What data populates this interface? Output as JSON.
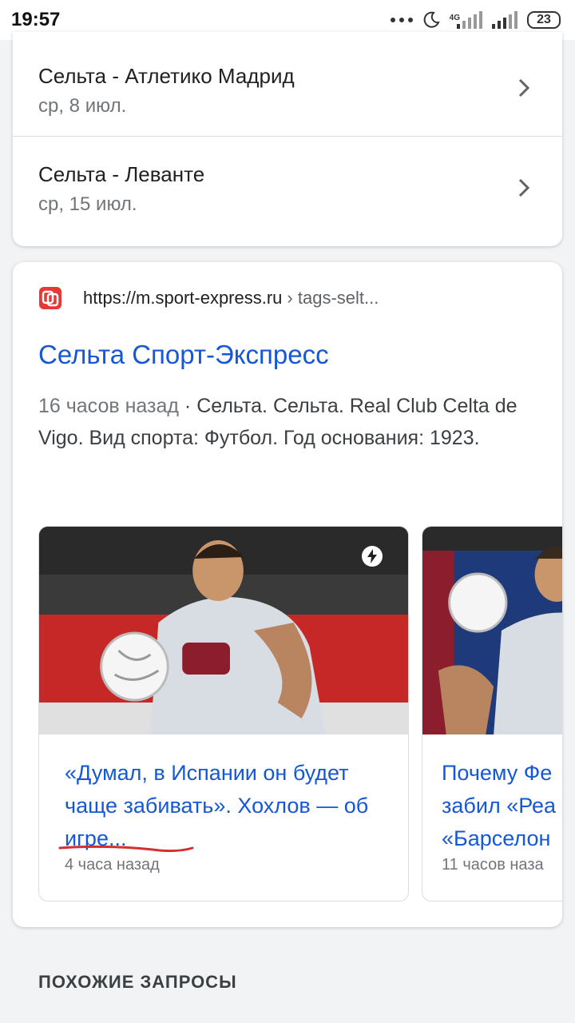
{
  "status_bar": {
    "time": "19:57",
    "network": "4G",
    "battery": "23",
    "icons": [
      "more-dots-icon",
      "moon-icon",
      "signal-4g-icon",
      "signal-icon",
      "battery-icon"
    ]
  },
  "matches": [
    {
      "title": "Сельта - Атлетико Мадрид",
      "date": "ср, 8 июл."
    },
    {
      "title": "Сельта - Леванте",
      "date": "ср, 15 июл."
    }
  ],
  "result": {
    "site_url": "https://m.sport-express.ru",
    "site_path": "› tags-selt...",
    "title": "Сельта Спорт-Экспресс",
    "snippet_time": "16 часов назад",
    "snippet_text": " · Сельта. Сельта. Real Club Celta de Vigo. Вид спорта: Футбол. Год основания: 1923.",
    "favicon_color": "#e53935"
  },
  "news": [
    {
      "headline": "«Думал, в Испании он будет чаще забивать». Хохлов — об игре...",
      "time": "4 часа назад"
    },
    {
      "headline": "Почему Фе\nзабил «Реа\n«Барселон",
      "time": "11 часов наза"
    }
  ],
  "related": {
    "heading": "ПОХОЖИЕ ЗАПРОСЫ"
  },
  "colors": {
    "link": "#1558d6",
    "annotation": "#d32f2f",
    "background": "#f1f3f4"
  }
}
